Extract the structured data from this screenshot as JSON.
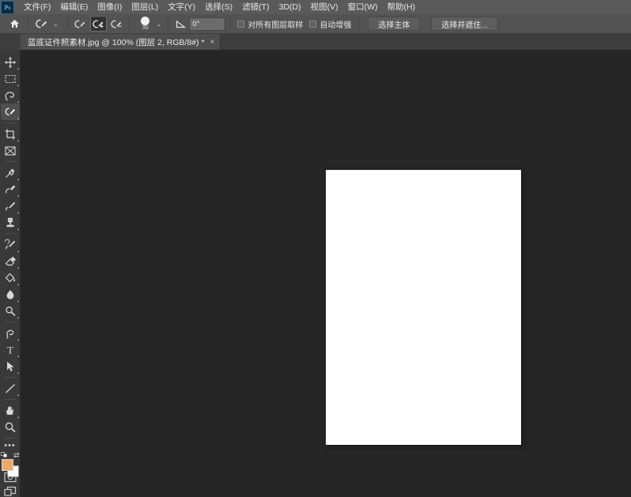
{
  "app": {
    "name": "Adobe Photoshop",
    "logo_text": "Ps",
    "bg_color": "#262626",
    "menubar_color": "#5a5a5a",
    "accent_color": "#2b6a9b"
  },
  "menubar": {
    "items": [
      {
        "label": "文件(F)",
        "name": "menu-file"
      },
      {
        "label": "编辑(E)",
        "name": "menu-edit"
      },
      {
        "label": "图像(I)",
        "name": "menu-image"
      },
      {
        "label": "图层(L)",
        "name": "menu-layer"
      },
      {
        "label": "文字(Y)",
        "name": "menu-type"
      },
      {
        "label": "选择(S)",
        "name": "menu-select"
      },
      {
        "label": "滤镜(T)",
        "name": "menu-filter"
      },
      {
        "label": "3D(D)",
        "name": "menu-3d"
      },
      {
        "label": "视图(V)",
        "name": "menu-view"
      },
      {
        "label": "窗口(W)",
        "name": "menu-window"
      },
      {
        "label": "帮助(H)",
        "name": "menu-help"
      }
    ]
  },
  "options_bar": {
    "home_icon": "home-icon",
    "tool_preset_icon": "quick-selection-tool-icon",
    "tool_preset_caret": "⌄",
    "selection_modes": [
      {
        "name": "new-selection-mode",
        "icon": "brush-new-selection-icon",
        "active": false
      },
      {
        "name": "add-to-selection-mode",
        "icon": "brush-add-selection-icon",
        "active": true
      },
      {
        "name": "subtract-from-selection-mode",
        "icon": "brush-subtract-selection-icon",
        "active": false
      }
    ],
    "brush_size_value": "30",
    "brush_caret": "⌄",
    "angle_icon": "angle-icon",
    "angle_value": "0°",
    "sample_all_layers_label": "对所有图层取样",
    "sample_all_layers_checked": false,
    "auto_enhance_label": "自动增强",
    "auto_enhance_checked": false,
    "select_subject_label": "选择主体",
    "select_and_mask_label": "选择并遮住..."
  },
  "document_tab": {
    "title": "蓝底证件照素材.jpg @ 100% (图层 2, RGB/8#) *",
    "close_icon": "×"
  },
  "toolbar": {
    "tools": [
      {
        "name": "tool-move",
        "icon": "move-icon",
        "active": false,
        "has_more": true
      },
      {
        "name": "tool-rectangular-select",
        "icon": "rectangular-marquee-icon",
        "active": false,
        "has_more": true
      },
      {
        "name": "tool-lasso",
        "icon": "lasso-icon",
        "active": false,
        "has_more": true
      },
      {
        "name": "tool-quick-selection",
        "icon": "quick-selection-icon",
        "active": true,
        "has_more": true
      },
      {
        "name": "tool-crop",
        "icon": "crop-icon",
        "active": false,
        "has_more": true
      },
      {
        "name": "tool-frame",
        "icon": "frame-icon",
        "active": false,
        "has_more": false
      },
      {
        "name": "tool-eyedropper",
        "icon": "eyedropper-icon",
        "active": false,
        "has_more": true
      },
      {
        "name": "tool-spot-healing",
        "icon": "healing-brush-icon",
        "active": false,
        "has_more": true
      },
      {
        "name": "tool-brush",
        "icon": "brush-icon",
        "active": false,
        "has_more": true
      },
      {
        "name": "tool-clone-stamp",
        "icon": "clone-stamp-icon",
        "active": false,
        "has_more": true
      },
      {
        "name": "tool-history-brush",
        "icon": "history-brush-icon",
        "active": false,
        "has_more": true
      },
      {
        "name": "tool-eraser",
        "icon": "eraser-icon",
        "active": false,
        "has_more": true
      },
      {
        "name": "tool-gradient",
        "icon": "paint-bucket-icon",
        "active": false,
        "has_more": true
      },
      {
        "name": "tool-blur",
        "icon": "blur-droplet-icon",
        "active": false,
        "has_more": true
      },
      {
        "name": "tool-dodge",
        "icon": "dodge-icon",
        "active": false,
        "has_more": true
      },
      {
        "name": "tool-pen",
        "icon": "pen-icon",
        "active": false,
        "has_more": true
      },
      {
        "name": "tool-type",
        "icon": "type-t-icon",
        "active": false,
        "has_more": true
      },
      {
        "name": "tool-path-selection",
        "icon": "path-selection-arrow-icon",
        "active": false,
        "has_more": true
      },
      {
        "name": "tool-shape",
        "icon": "line-shape-icon",
        "active": false,
        "has_more": true
      },
      {
        "name": "tool-hand",
        "icon": "hand-icon",
        "active": false,
        "has_more": true
      },
      {
        "name": "tool-zoom",
        "icon": "zoom-magnifier-icon",
        "active": false,
        "has_more": false
      }
    ],
    "more_tools_icon": "ellipsis-more-tools-icon",
    "foreground_color": "#f0a868",
    "background_color": "#ffffff",
    "default_colors_icon": "default-colors-icon",
    "swap_colors_icon": "swap-colors-icon",
    "quick_mask_icon": "quick-mask-icon",
    "screen_mode_icon": "screen-mode-icon"
  },
  "canvas": {
    "document_fill": "#ffffff",
    "zoom_level": "100%",
    "background_color": "#262626"
  }
}
